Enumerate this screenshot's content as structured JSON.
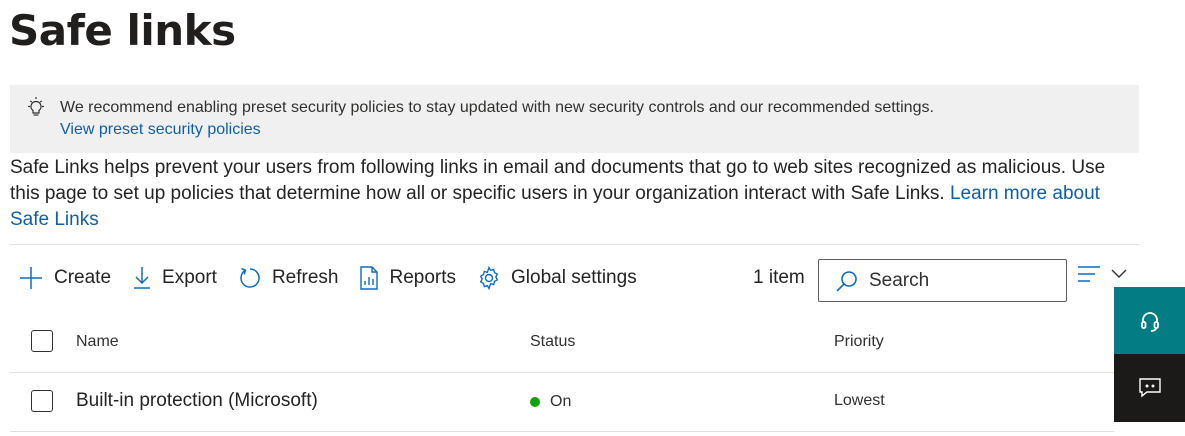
{
  "page": {
    "title": "Safe links"
  },
  "banner": {
    "icon": "lightbulb-icon",
    "message": "We recommend enabling preset security policies to stay updated with new security controls and our recommended settings.",
    "link": "View preset security policies"
  },
  "description": {
    "text": "Safe Links helps prevent your users from following links in email and documents that go to web sites recognized as malicious. Use this page to set up policies that determine how all or specific users in your organization interact with Safe Links.",
    "learn_more": "Learn more about Safe Links"
  },
  "toolbar": {
    "create": "Create",
    "export": "Export",
    "refresh": "Refresh",
    "reports": "Reports",
    "global_settings": "Global settings",
    "item_count": "1 item",
    "search_placeholder": "Search"
  },
  "table": {
    "columns": {
      "name": "Name",
      "status": "Status",
      "priority": "Priority"
    },
    "rows": [
      {
        "name": "Built-in protection (Microsoft)",
        "status": "On",
        "status_color": "#13a10e",
        "priority": "Lowest"
      }
    ]
  },
  "colors": {
    "link": "#0f5fa6",
    "help_panel": "#037c83",
    "chat_panel": "#1b1a19",
    "banner_bg": "#f0f0f0"
  }
}
